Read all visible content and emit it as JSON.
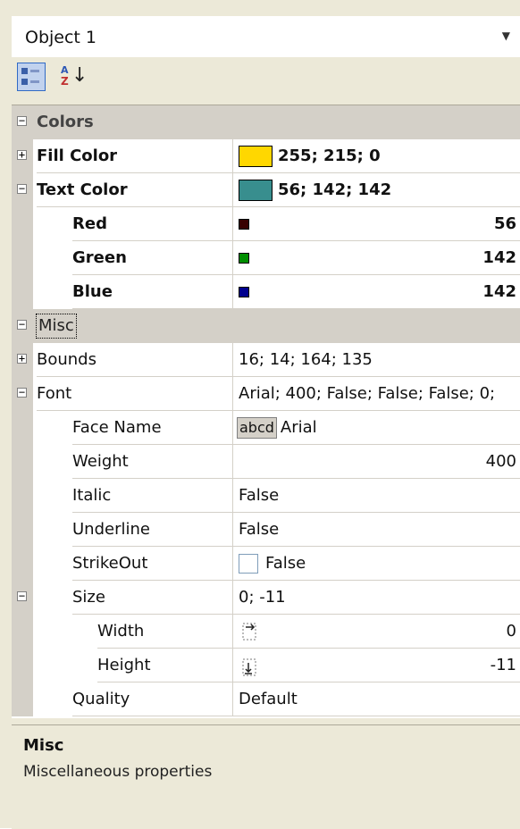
{
  "object_selector": {
    "value": "Object 1"
  },
  "toolbar": {
    "categorized_icon": "categorized-icon",
    "alphabetical_icon": "sort-alphabetical-icon"
  },
  "grid": {
    "colors": {
      "label": "Colors",
      "fill_color": {
        "name": "Fill Color",
        "value": "255; 215; 0",
        "swatch": "#ffd700"
      },
      "text_color": {
        "name": "Text Color",
        "value": "56; 142; 142",
        "swatch": "#388e8e"
      },
      "red": {
        "name": "Red",
        "value": "56",
        "swatch": "#380000"
      },
      "green": {
        "name": "Green",
        "value": "142",
        "swatch": "#008e00"
      },
      "blue": {
        "name": "Blue",
        "value": "142",
        "swatch": "#00008e"
      }
    },
    "misc": {
      "label": "Misc",
      "bounds": {
        "name": "Bounds",
        "value": "16; 14; 164; 135"
      },
      "font": {
        "name": "Font",
        "value": "Arial; 400; False; False; False; 0;"
      },
      "face_name": {
        "name": "Face Name",
        "preview": "abcd",
        "value": "Arial"
      },
      "weight": {
        "name": "Weight",
        "value": "400"
      },
      "italic": {
        "name": "Italic",
        "value": "False"
      },
      "underline": {
        "name": "Underline",
        "value": "False"
      },
      "strikeout": {
        "name": "StrikeOut",
        "value": "False"
      },
      "size": {
        "name": "Size",
        "value": "0; -11"
      },
      "width": {
        "name": "Width",
        "value": "0"
      },
      "height": {
        "name": "Height",
        "value": "-11"
      },
      "quality": {
        "name": "Quality",
        "value": "Default"
      }
    }
  },
  "description": {
    "title": "Misc",
    "text": "Miscellaneous properties"
  }
}
